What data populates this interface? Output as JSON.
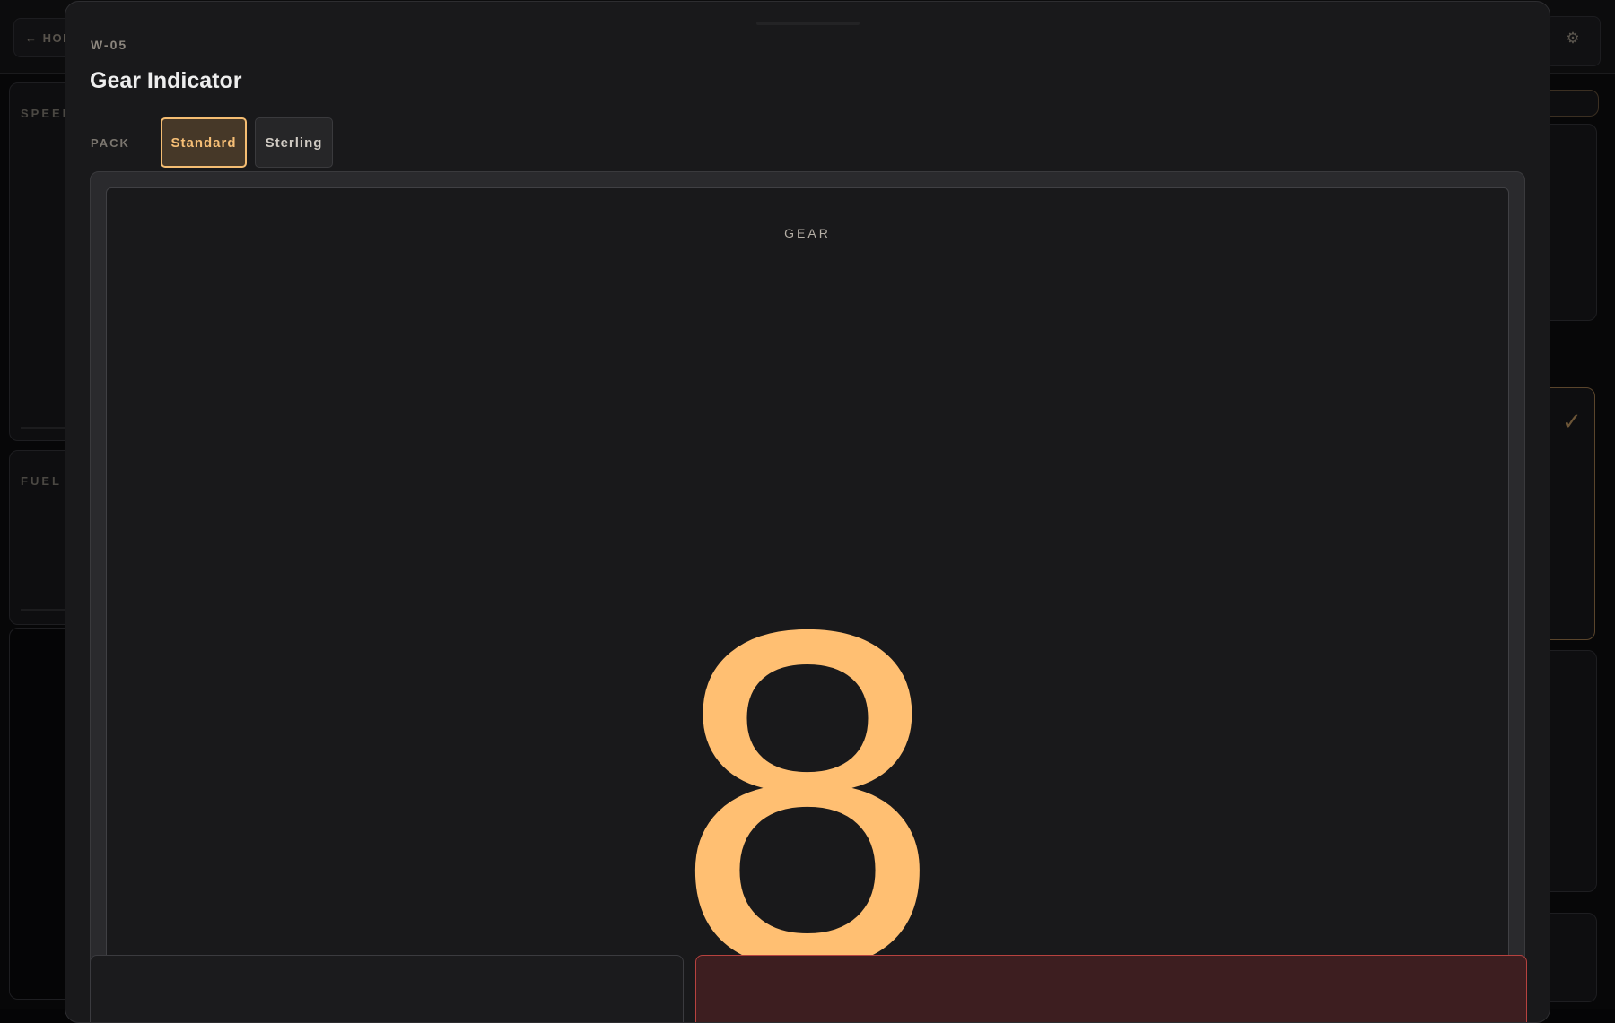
{
  "background": {
    "home_label": "← HOME",
    "settings_icon": "⚙",
    "cards": {
      "speed_label": "SPEED",
      "fuel_label": "FUEL"
    },
    "check_icon": "✓"
  },
  "modal": {
    "widget_id": "W-05",
    "title": "Gear Indicator",
    "pack": {
      "label": "PACK",
      "options": [
        "Standard",
        "Sterling"
      ],
      "selected": "Standard"
    },
    "preview": {
      "label": "GEAR",
      "value": "8"
    }
  },
  "colors": {
    "accent": "#ffbf72",
    "danger": "#b7423f",
    "surface": "#19191b"
  }
}
